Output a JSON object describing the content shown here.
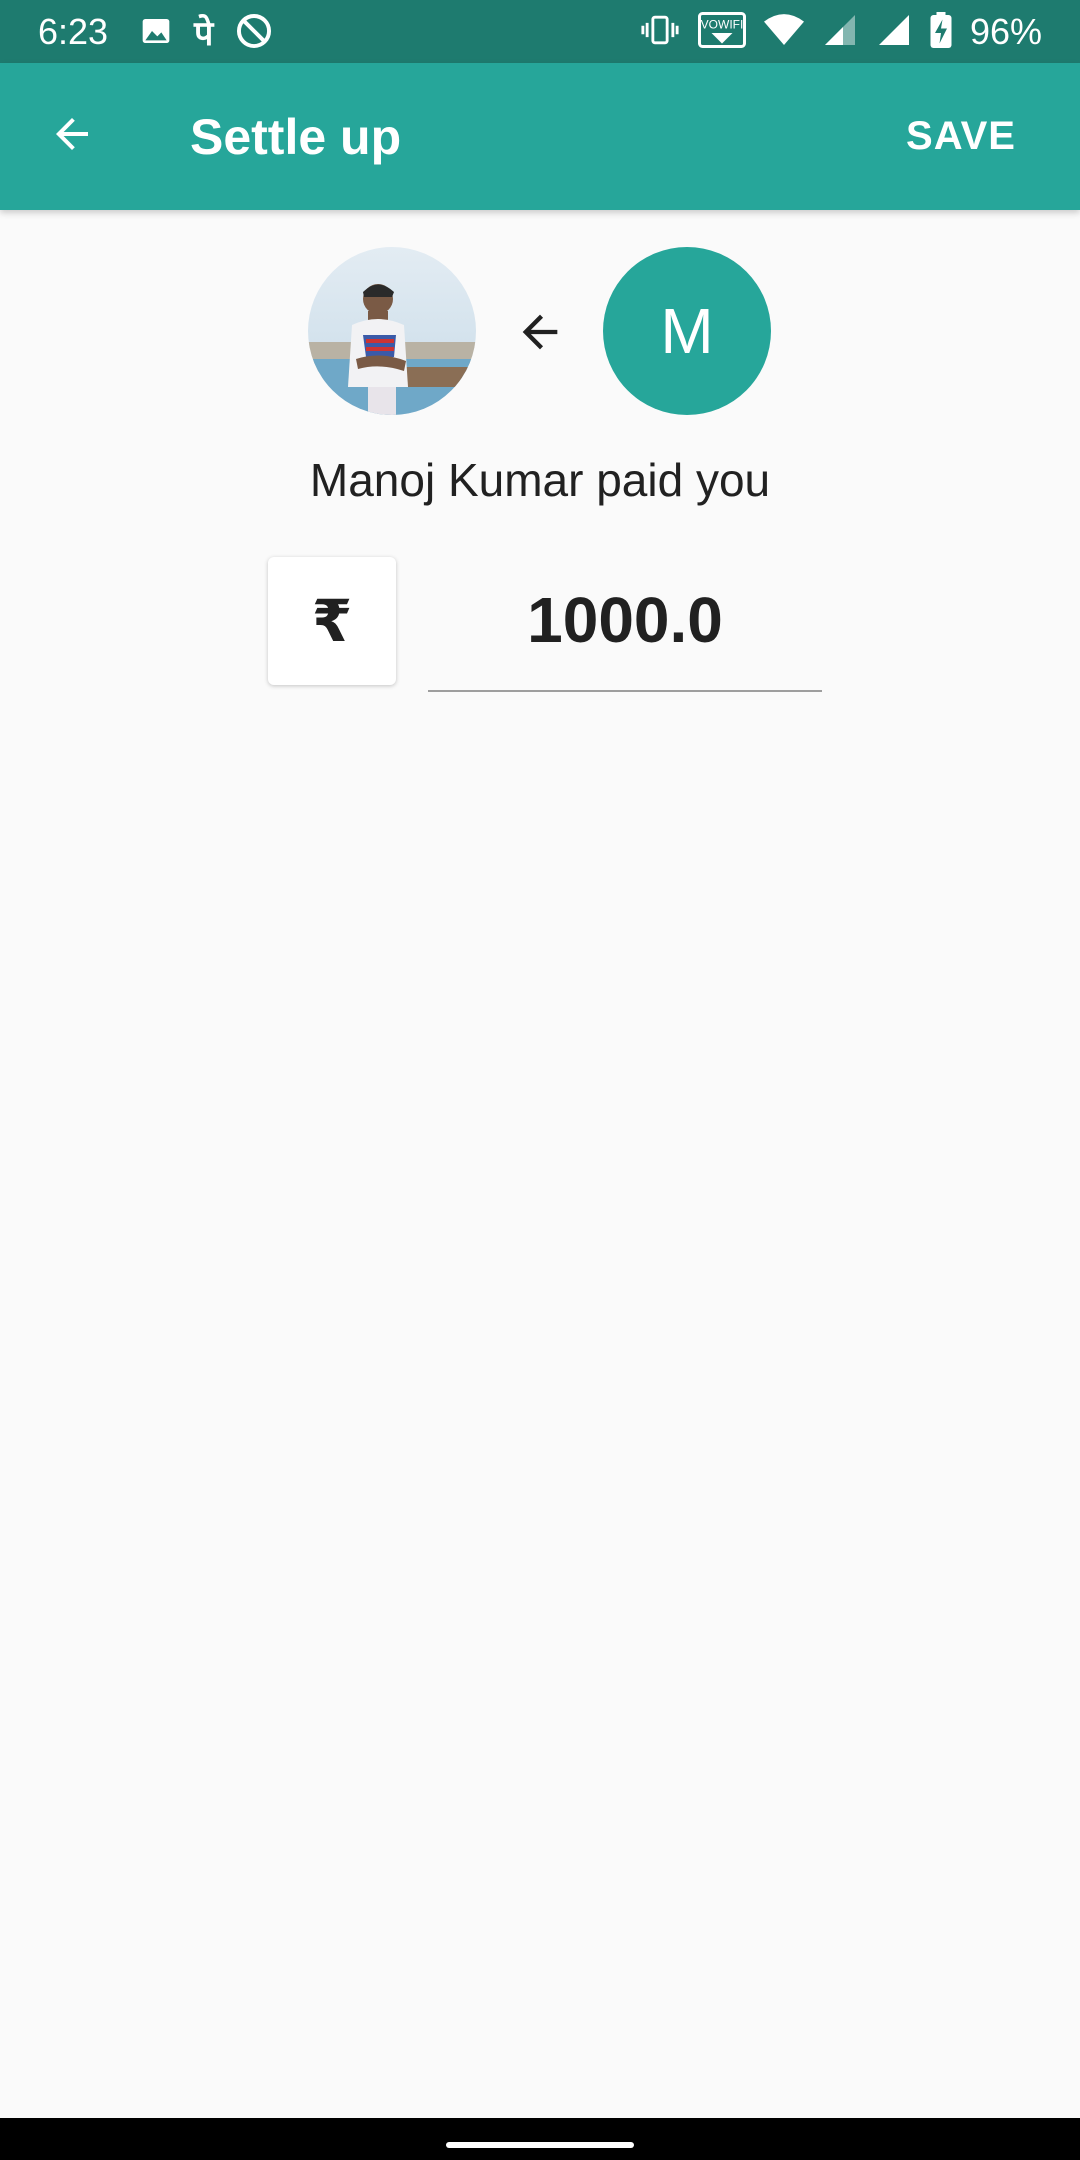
{
  "status_bar": {
    "time": "6:23",
    "left_icons": [
      "image-icon",
      "phonepe-icon",
      "no-disturb-icon"
    ],
    "right_icons": [
      "vibrate-icon",
      "vowifi-icon",
      "wifi-icon",
      "signal-icon",
      "signal-full-icon",
      "battery-charging-icon"
    ],
    "vowifi_label": "VOWIFI",
    "phonepe_glyph": "पे",
    "battery_pct": "96%"
  },
  "app_bar": {
    "title": "Settle up",
    "save_label": "SAVE",
    "color": "#26a69a"
  },
  "payer": {
    "initial": "M",
    "color": "#26a69a"
  },
  "summary_text": "Manoj Kumar paid you",
  "currency": {
    "symbol": "₹"
  },
  "amount": {
    "value": "1000.0"
  }
}
